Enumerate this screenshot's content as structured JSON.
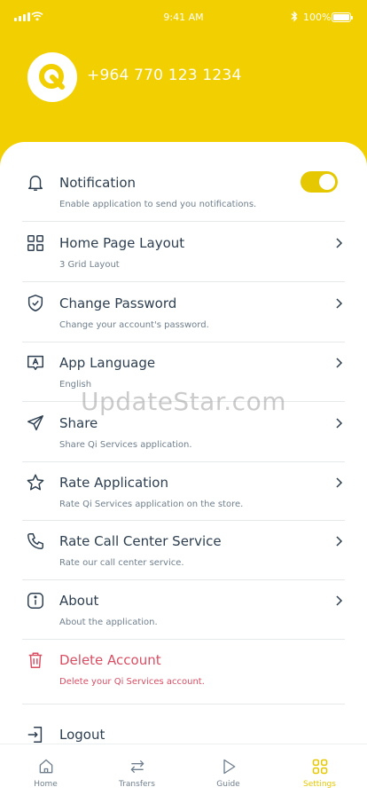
{
  "status": {
    "time": "9:41 AM",
    "battery": "100%"
  },
  "profile": {
    "phone": "+964 770 123 1234"
  },
  "settings": {
    "notification": {
      "title": "Notification",
      "subtitle": "Enable application to send you notifications.",
      "enabled": true
    },
    "items": [
      {
        "title": "Home Page Layout",
        "subtitle": "3 Grid Layout",
        "icon": "grid-icon"
      },
      {
        "title": "Change Password",
        "subtitle": "Change your account's password.",
        "icon": "shield-check-icon"
      },
      {
        "title": "App Language",
        "subtitle": "English",
        "icon": "language-icon"
      },
      {
        "title": "Share",
        "subtitle": "Share Qi Services application.",
        "icon": "send-icon"
      },
      {
        "title": "Rate Application",
        "subtitle": "Rate Qi Services application on the store.",
        "icon": "star-icon"
      },
      {
        "title": "Rate Call Center Service",
        "subtitle": "Rate our call center service.",
        "icon": "phone-icon"
      },
      {
        "title": "About",
        "subtitle": "About the application.",
        "icon": "info-icon"
      }
    ],
    "delete_account": {
      "title": "Delete Account",
      "subtitle": "Delete your Qi Services account."
    },
    "logout": {
      "title": "Logout"
    }
  },
  "watermark": "UpdateStar.com",
  "tabs": [
    {
      "label": "Home",
      "icon": "home-icon",
      "active": false
    },
    {
      "label": "Transfers",
      "icon": "transfer-icon",
      "active": false
    },
    {
      "label": "Guide",
      "icon": "play-icon",
      "active": false
    },
    {
      "label": "Settings",
      "icon": "grid-icon",
      "active": true
    }
  ],
  "colors": {
    "brand": "#f2cf00",
    "accent": "#e6c800",
    "text": "#2c3e50",
    "danger": "#d94e63"
  }
}
